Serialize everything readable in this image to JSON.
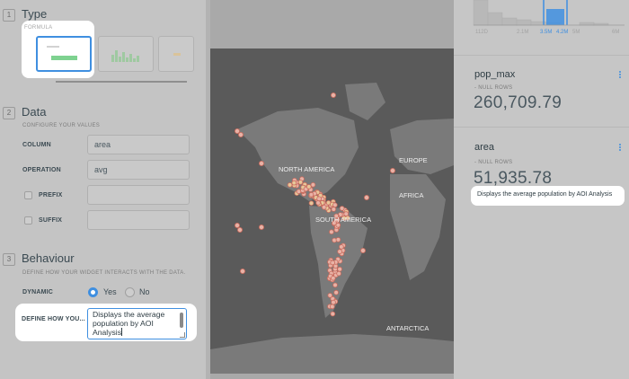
{
  "editor": {
    "type_section": {
      "number": "1",
      "title": "Type",
      "selected_type": "FORMULA"
    },
    "data_section": {
      "number": "2",
      "title": "Data",
      "subtitle": "CONFIGURE YOUR VALUES",
      "column_label": "COLUMN",
      "column_value": "area",
      "operation_label": "OPERATION",
      "operation_value": "avg",
      "prefix_label": "PREFIX",
      "prefix_value": "",
      "suffix_label": "SUFFIX",
      "suffix_value": ""
    },
    "behaviour_section": {
      "number": "3",
      "title": "Behaviour",
      "subtitle": "DEFINE HOW YOUR WIDGET INTERACTS WITH THE DATA.",
      "dynamic_label": "DYNAMIC",
      "dynamic_options": [
        "Yes",
        "No"
      ],
      "dynamic_selected": "Yes"
    },
    "description": {
      "label": "DEFINE HOW YOU...",
      "value": "Displays the average population by AOI Analysis"
    }
  },
  "map": {
    "labels": [
      "NORTH AMERICA",
      "EUROPE",
      "AFRICA",
      "SOUTH AMERICA",
      "ANTARCTICA"
    ]
  },
  "widgets": {
    "histogram": {
      "tick_labels": [
        "112D",
        "2.1M",
        "3.5M",
        "4.2M",
        "5M",
        "6M"
      ],
      "selected_range": [
        "3.5M",
        "4.2M"
      ]
    },
    "pop_max": {
      "title": "pop_max",
      "null_rows": "- NULL ROWS",
      "value": "260,709.79"
    },
    "area": {
      "title": "area",
      "null_rows": "- NULL ROWS",
      "value": "51,935.78",
      "description": "Displays the average population by AOI Analysis"
    }
  },
  "colors": {
    "accent": "#3f8fe0",
    "map_bg": "#5a5a5a",
    "land": "#7a7a7a",
    "point_fill": "#e8b2a6",
    "point_stroke": "#c86a5c",
    "dense_point": "#e7c79a"
  }
}
